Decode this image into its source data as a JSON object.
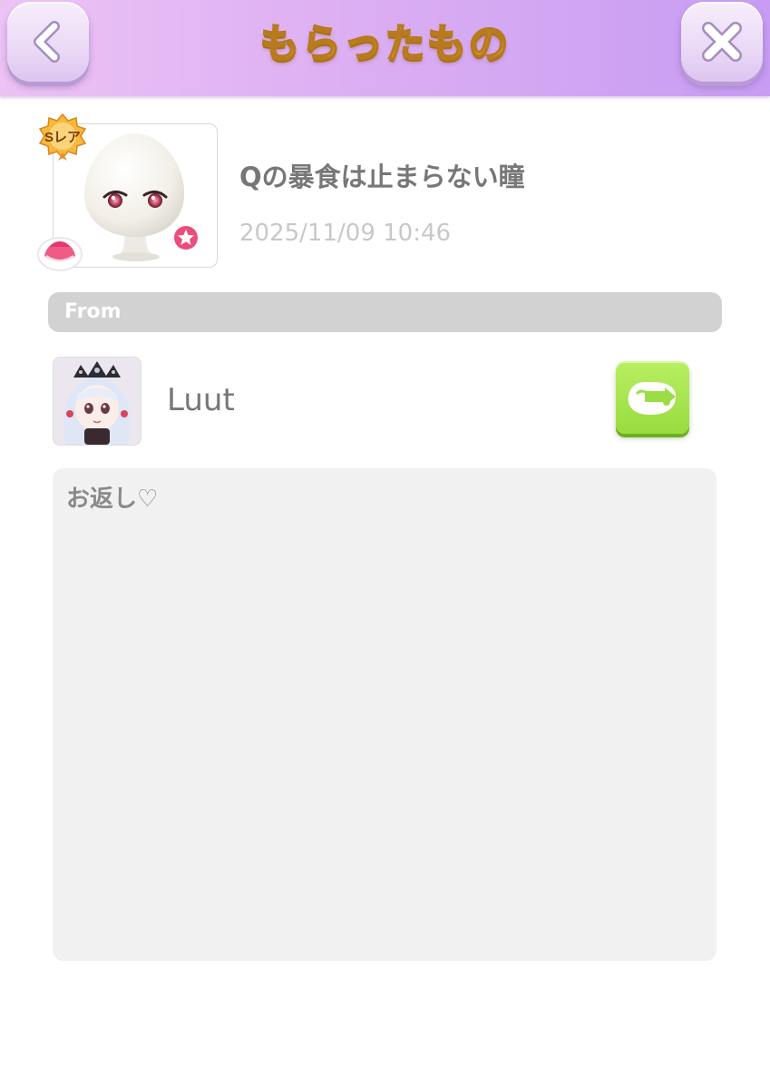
{
  "header": {
    "title": "もらったもの",
    "back_icon": "chevron-left-icon",
    "close_icon": "close-x-icon"
  },
  "item": {
    "rarity_label": "Sレア",
    "title": "Qの暴食は止まらない瞳",
    "date": "2025/11/09 10:46",
    "category_icon": "clothing-category-icon",
    "favorite_icon": "star-icon",
    "accent_color": "#ec4d7c"
  },
  "from": {
    "label": "From",
    "sender_name": "Luut",
    "reply_icon": "reply-gift-icon",
    "reply_color": "#a6e24c"
  },
  "message": {
    "text": "お返し♡"
  },
  "colors": {
    "header_gradient_start": "#ecc3f4",
    "header_gradient_end": "#c79cf2",
    "title_gold": "#f6c255"
  }
}
